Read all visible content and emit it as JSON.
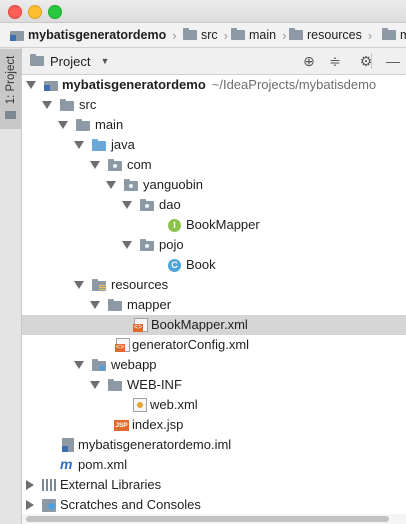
{
  "window": {
    "traffic_lights": [
      "close",
      "minimize",
      "maximize"
    ]
  },
  "breadcrumb": {
    "items": [
      {
        "label": "mybatisgeneratordemo",
        "icon": "module-icon"
      },
      {
        "label": "src",
        "icon": "folder-icon"
      },
      {
        "label": "main",
        "icon": "folder-icon"
      },
      {
        "label": "resources",
        "icon": "resources-folder-icon"
      },
      {
        "label": "m",
        "icon": "folder-icon"
      }
    ]
  },
  "side_panel": {
    "tab_label": "1: Project"
  },
  "toolbar": {
    "view_label": "Project",
    "icons": [
      "locate-icon",
      "collapse-icon",
      "settings-icon",
      "hide-icon"
    ]
  },
  "tree": {
    "root_label": "mybatisgeneratordemo",
    "root_path": "~/IdeaProjects/mybatisdemo",
    "src": "src",
    "main": "main",
    "java": "java",
    "com": "com",
    "yanguobin": "yanguobin",
    "dao": "dao",
    "bookmapper": "BookMapper",
    "pojo": "pojo",
    "book": "Book",
    "resources": "resources",
    "mapper": "mapper",
    "bookmapper_xml": "BookMapper.xml",
    "generator_config": "generatorConfig.xml",
    "webapp": "webapp",
    "web_inf": "WEB-INF",
    "web_xml": "web.xml",
    "index_jsp": "index.jsp",
    "iml": "mybatisgeneratordemo.iml",
    "pom": "pom.xml",
    "external_libraries": "External Libraries",
    "scratches": "Scratches and Consoles",
    "selected": "BookMapper.xml"
  },
  "colors": {
    "selection": "#d5d5d5",
    "interface_badge": "#8bc34a",
    "class_badge": "#4da6d9",
    "xml_badge": "#e2692b",
    "source_folder": "#6aa7d8"
  }
}
